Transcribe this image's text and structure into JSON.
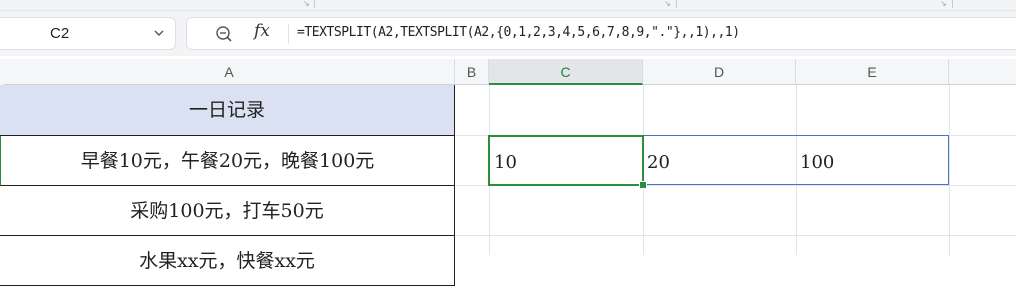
{
  "name_box": {
    "ref": "C2"
  },
  "formula_bar": {
    "fx_label": "fx",
    "formula": "=TEXTSPLIT(A2,TEXTSPLIT(A2,{0,1,2,3,4,5,6,7,8,9,\".\"},,1),,1)"
  },
  "columns": [
    "A",
    "B",
    "C",
    "D",
    "E"
  ],
  "selected_column": "C",
  "column_a": {
    "title": "一日记录",
    "row2": "早餐10元，午餐20元，晚餐100元",
    "row3": "采购100元，打车50元",
    "row4": "水果xx元，快餐xx元"
  },
  "results": {
    "c2": "10",
    "d2": "20",
    "e2": "100"
  },
  "colors": {
    "selection": "#2d8d3f",
    "spill": "#3b7ac6",
    "title_fill": "#d9e1f3"
  },
  "icons": [
    "chevron-down-icon",
    "zoom-icon",
    "fx-icon"
  ]
}
